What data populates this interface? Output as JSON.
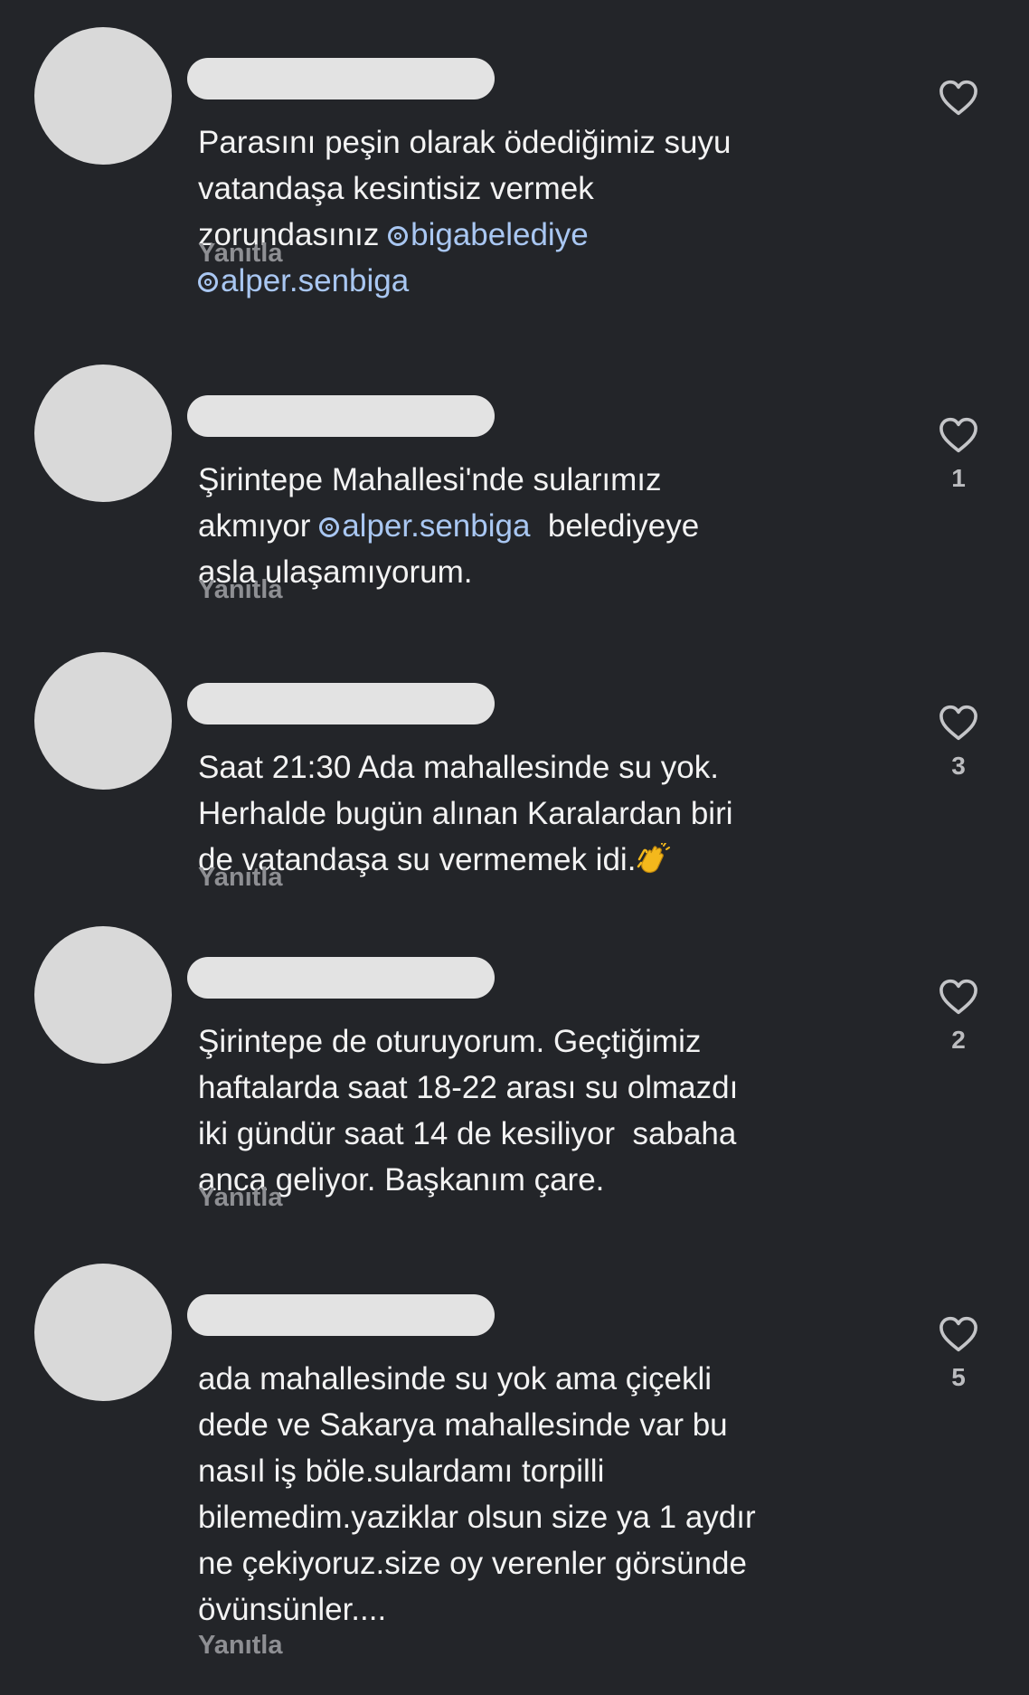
{
  "comments": [
    {
      "text_parts": [
        "Parasını peşin olarak ödediğimiz suyu",
        "vatandaşa kesintisiz vermek",
        "zorundasınız "
      ],
      "mentions": [
        "bigabelediye",
        "alper.senbiga"
      ],
      "reply_label": "Yanıtla",
      "like_count": ""
    },
    {
      "line1": "Şirintepe Mahallesi'nde sularımız",
      "line2_before": "akmıyor ",
      "mention": "alper.senbiga",
      "line2_after": "  belediyeye",
      "line3": "asla ulaşamıyorum.",
      "reply_label": "Yanıtla",
      "like_count": "1"
    },
    {
      "line1": "Saat 21:30 Ada mahallesinde su yok.",
      "line2": "Herhalde bugün alınan Karalardan biri",
      "line3": "de vatandaşa su vermemek idi.",
      "emoji": "clapping-hands-emoji",
      "reply_label": "Yanıtla",
      "like_count": "3"
    },
    {
      "lines": [
        "Şirintepe de oturuyorum. Geçtiğimiz",
        "haftalarda saat 18-22 arası su olmazdı",
        "iki gündür saat 14 de kesiliyor  sabaha",
        "anca geliyor. Başkanım çare."
      ],
      "reply_label": "Yanıtla",
      "like_count": "2"
    },
    {
      "lines": [
        "ada mahallesinde su yok ama çiçekli",
        "dede ve Sakarya mahallesinde var bu",
        "nasıl iş böle.sulardamı torpilli",
        "bilemedim.yaziklar olsun size ya 1 aydır",
        "ne çekiyoruz.size oy verenler görsünde",
        "övünsünler...."
      ],
      "reply_label": "Yanıtla",
      "like_count": "5"
    }
  ],
  "colors": {
    "background": "#232529",
    "text": "#f3f3f3",
    "mention": "#a9c7f2",
    "muted": "#8e8f93",
    "avatar_placeholder": "#d9d9d9"
  }
}
